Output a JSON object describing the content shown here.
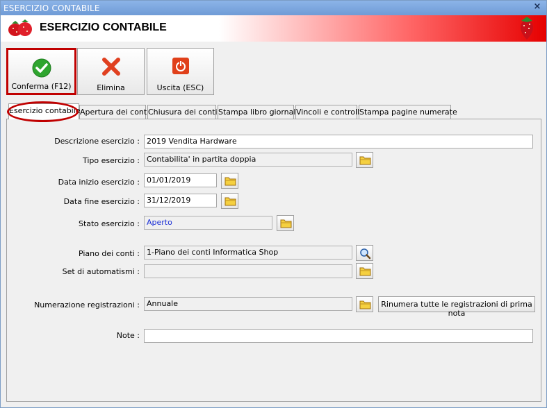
{
  "window": {
    "title": "ESERCIZIO CONTABILE",
    "close_glyph": "×"
  },
  "header": {
    "title": "ESERCIZIO CONTABILE"
  },
  "toolbar": {
    "confirm_label": "Conferma (F12)",
    "delete_label": "Elimina",
    "exit_label": "Uscita (ESC)"
  },
  "tabs": [
    {
      "label": "Esercizio contabile"
    },
    {
      "label": "Apertura dei conti"
    },
    {
      "label": "Chiusura dei conti"
    },
    {
      "label": "Stampa libro giornale"
    },
    {
      "label": "Vincoli e controlli"
    },
    {
      "label": "Stampa pagine numerate"
    }
  ],
  "form": {
    "descrizione": {
      "label": "Descrizione esercizio :",
      "value": "2019 Vendita Hardware"
    },
    "tipo": {
      "label": "Tipo esercizio :",
      "value": "Contabilita' in partita doppia"
    },
    "data_inizio": {
      "label": "Data inizio esercizio :",
      "value": "01/01/2019"
    },
    "data_fine": {
      "label": "Data fine esercizio :",
      "value": "31/12/2019"
    },
    "stato": {
      "label": "Stato esercizio :",
      "value": "Aperto"
    },
    "piano": {
      "label": "Piano dei conti :",
      "value": "1-Piano dei conti Informatica Shop"
    },
    "automatismi": {
      "label": "Set di automatismi :",
      "value": ""
    },
    "numerazione": {
      "label": "Numerazione registrazioni :",
      "value": "Annuale"
    },
    "rinumera_label": "Rinumera tutte le registrazioni di prima nota",
    "note": {
      "label": "Note :",
      "value": ""
    }
  },
  "colors": {
    "accent_red": "#c00000",
    "status_blue": "#1b2fd6"
  }
}
